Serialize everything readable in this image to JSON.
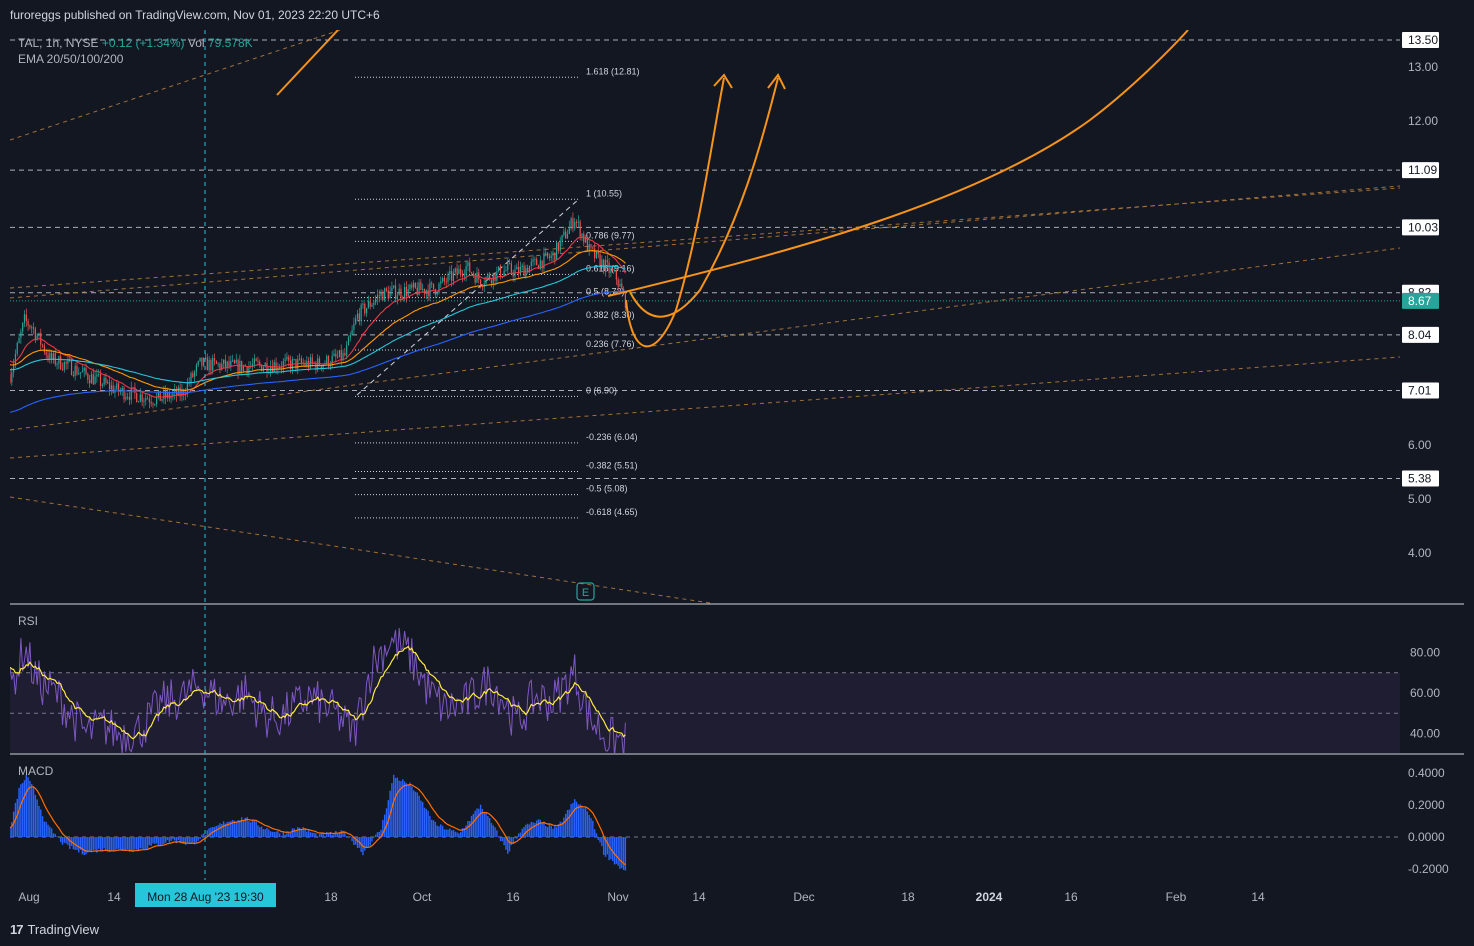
{
  "header": {
    "publisher": "furoreggs published on TradingView.com, Nov 01, 2023 22:20 UTC+6"
  },
  "legend": {
    "symbol": "TAL, 1h, NYSE",
    "change": "+0.12 (+1.34%)",
    "volume_label": "Vol",
    "volume_value": "79.578K",
    "ema_label": "EMA 20/50/100/200"
  },
  "footer": {
    "brand": "TradingView"
  },
  "chart_data": [
    {
      "type": "line",
      "title": "TAL, 1h, NYSE",
      "y_ticks": [
        "4.00",
        "5.00",
        "6.00",
        "12.00",
        "13.00"
      ],
      "y_tick_values": [
        4,
        5,
        6,
        12,
        13
      ],
      "x_ticks": [
        "Aug",
        "14",
        "18",
        "Oct",
        "16",
        "Nov",
        "14",
        "Dec",
        "18",
        "2024",
        "16",
        "Feb",
        "14"
      ],
      "x_tick_bold": [
        "2024"
      ],
      "crosshair_label": "Mon 28 Aug '23   19:30",
      "price_labels": [
        {
          "text": "13.50",
          "value": 13.5,
          "style": "dark"
        },
        {
          "text": "11.09",
          "value": 11.09,
          "style": "dark"
        },
        {
          "text": "10.03",
          "value": 10.03,
          "style": "dark"
        },
        {
          "text": "8.82",
          "value": 8.82,
          "style": "dark"
        },
        {
          "text": "8.67",
          "value": 8.67,
          "style": "last"
        },
        {
          "text": "8.04",
          "value": 8.04,
          "style": "dark"
        },
        {
          "text": "7.01",
          "value": 7.01,
          "style": "dark"
        },
        {
          "text": "5.38",
          "value": 5.38,
          "style": "dark"
        }
      ],
      "fib_levels": [
        {
          "label": "1.618 (12.81)",
          "value": 12.81
        },
        {
          "label": "1 (10.55)",
          "value": 10.55
        },
        {
          "label": "0.786 (9.77)",
          "value": 9.77
        },
        {
          "label": "0.618 (9.16)",
          "value": 9.16
        },
        {
          "label": "0.5 (8.73)",
          "value": 8.73
        },
        {
          "label": "0.382 (8.30)",
          "value": 8.3
        },
        {
          "label": "0.236 (7.76)",
          "value": 7.76
        },
        {
          "label": "0 (6.90)",
          "value": 6.9
        },
        {
          "label": "-0.236 (6.04)",
          "value": 6.04
        },
        {
          "label": "-0.382 (5.51)",
          "value": 5.51
        },
        {
          "label": "-0.5 (5.08)",
          "value": 5.08
        },
        {
          "label": "-0.618 (4.65)",
          "value": 4.65
        }
      ],
      "earnings_marker": "E",
      "last_price": 8.67,
      "ylim": [
        3.5,
        13.5
      ],
      "colors": {
        "ema20": "#f23645",
        "ema50": "#ff9800",
        "ema100": "#26c6da",
        "ema200": "#2962ff",
        "drawing": "#f7931a"
      }
    },
    {
      "type": "line",
      "title": "RSI",
      "y_ticks": [
        "40.00",
        "60.00",
        "80.00"
      ],
      "y_tick_values": [
        40,
        60,
        80
      ],
      "band": [
        30,
        70
      ],
      "ylim": [
        25,
        95
      ],
      "colors": {
        "rsi": "#7e57c2",
        "smooth": "#ffeb3b"
      }
    },
    {
      "type": "bar",
      "title": "MACD",
      "y_ticks": [
        "-0.2000",
        "0.0000",
        "0.2000",
        "0.4000"
      ],
      "y_tick_values": [
        -0.2,
        0,
        0.2,
        0.4
      ],
      "ylim": [
        -0.25,
        0.45
      ],
      "colors": {
        "histogram": "#2962ff",
        "signal": "#ff6d00"
      }
    }
  ]
}
